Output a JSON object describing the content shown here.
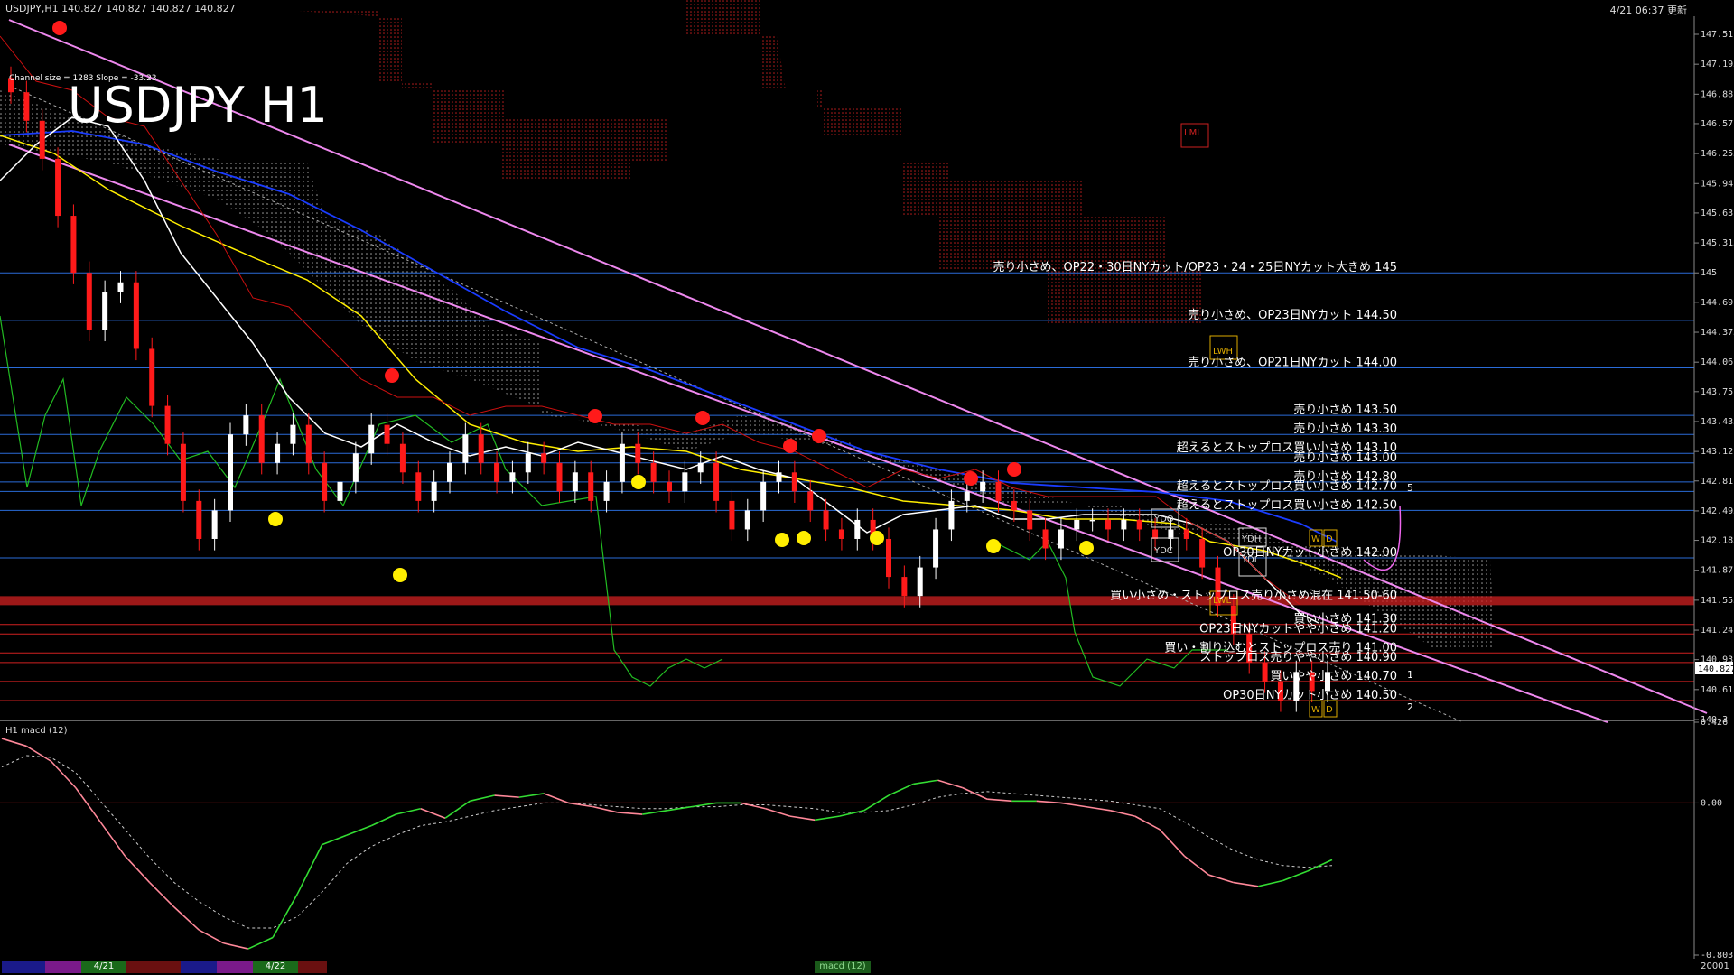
{
  "header": {
    "symbol_line": "USDJPY,H1  140.827 140.827 140.827 140.827",
    "datetime": "4/21 06:37 更新"
  },
  "chart_title": "USDJPY H1",
  "channel_info": "Channel size = 1283 Slope = -33.23",
  "colors": {
    "bg": "#000000",
    "bull": "#ffffff",
    "bear": "#ff1a1a",
    "sma_fast": "#ffffff",
    "sma_mid": "#ffee00",
    "sma_slow": "#1a3cff",
    "chikou": "#22bb22",
    "channel": "#ee88ee",
    "cloud_red": "#cc2020",
    "cloud_white": "#c8c8c8",
    "level_blue": "#2a6bd8",
    "level_red": "#d02020",
    "macd_up": "#33dd33",
    "macd_down": "#ff8899",
    "signal": "#cccccc"
  },
  "chart_data": [
    {
      "type": "line",
      "panel": "price",
      "symbol": "USDJPY",
      "timeframe": "H1",
      "ylim": [
        140.3,
        147.7
      ],
      "y_ticks": [
        147.51,
        147.195,
        146.88,
        146.57,
        146.255,
        145.94,
        145.63,
        145.315,
        145.0,
        144.69,
        144.375,
        144.06,
        143.75,
        143.435,
        143.12,
        142.81,
        142.495,
        142.185,
        141.87,
        141.555,
        141.24,
        140.93,
        140.615,
        140.3
      ],
      "current_price": "140.827",
      "price_closes": [
        146.9,
        146.6,
        146.2,
        145.6,
        145.0,
        144.4,
        144.8,
        144.9,
        144.2,
        143.6,
        143.2,
        142.6,
        142.2,
        142.5,
        143.3,
        143.5,
        143.0,
        143.2,
        143.4,
        143.0,
        142.6,
        142.8,
        143.1,
        143.4,
        143.2,
        142.9,
        142.6,
        142.8,
        143.0,
        143.3,
        143.0,
        142.8,
        142.9,
        143.1,
        143.0,
        142.7,
        142.9,
        142.6,
        142.8,
        143.2,
        143.0,
        142.8,
        142.7,
        142.9,
        143.0,
        142.6,
        142.3,
        142.5,
        142.8,
        142.9,
        142.7,
        142.5,
        142.3,
        142.2,
        142.4,
        142.2,
        141.8,
        141.6,
        141.9,
        142.3,
        142.6,
        142.7,
        142.8,
        142.6,
        142.5,
        142.3,
        142.1,
        142.3,
        142.4,
        142.4,
        142.3,
        142.4,
        142.3,
        142.2,
        142.3,
        142.2,
        141.9,
        141.5,
        141.2,
        140.9,
        140.7,
        140.5,
        140.8,
        140.6,
        140.8
      ],
      "levels": [
        {
          "price": 145.0,
          "color": "#2a6bd8",
          "label": "売り小さめ、OP22・30日NYカット/OP23・24・25日NYカット大きめ 145"
        },
        {
          "price": 144.5,
          "color": "#2a6bd8",
          "label": "売り小さめ、OP23日NYカット 144.50"
        },
        {
          "price": 144.0,
          "color": "#2a6bd8",
          "label": "売り小さめ、OP21日NYカット 144.00"
        },
        {
          "price": 143.5,
          "color": "#2a6bd8",
          "label": "売り小さめ 143.50"
        },
        {
          "price": 143.3,
          "color": "#2a6bd8",
          "label": "売り小さめ 143.30"
        },
        {
          "price": 143.1,
          "color": "#2a6bd8",
          "label": "超えるとストップロス買い小さめ 143.10"
        },
        {
          "price": 143.0,
          "color": "#2a6bd8",
          "label": "売り小さめ 143.00"
        },
        {
          "price": 142.8,
          "color": "#2a6bd8",
          "label": "売り小さめ 142.80"
        },
        {
          "price": 142.7,
          "color": "#2a6bd8",
          "label": "超えるとストップロス買い小さめ 142.70"
        },
        {
          "price": 142.5,
          "color": "#2a6bd8",
          "label": "超えるとストップロス買い小さめ 142.50"
        },
        {
          "price": 142.0,
          "color": "#2a6bd8",
          "label": "OP30日NYカット小さめ 142.00"
        },
        {
          "price": 141.55,
          "color": "#d02020",
          "label": "買い小さめ・ストップロス売り小さめ混在 141.50-60"
        },
        {
          "price": 141.3,
          "color": "#d02020",
          "label": "買い小さめ 141.30"
        },
        {
          "price": 141.2,
          "color": "#d02020",
          "label": "OP23日NYカットやや小さめ 141.20"
        },
        {
          "price": 141.0,
          "color": "#d02020",
          "label": "買い・割り込むとストップロス売り 141.00"
        },
        {
          "price": 140.9,
          "color": "#d02020",
          "label": "ストップロス売りやや小さめ 140.90"
        },
        {
          "price": 140.7,
          "color": "#d02020",
          "label": "買いやや小さめ 140.70"
        },
        {
          "price": 140.5,
          "color": "#d02020",
          "label": "OP30日NYカット小さめ 140.50"
        }
      ],
      "markers_text": [
        "LML",
        "LWH",
        "YDO",
        "YDC",
        "YDH",
        "YDL",
        "LWL",
        "W",
        "D",
        "W",
        "D"
      ],
      "right_numbers": [
        "5",
        "1",
        "2"
      ]
    },
    {
      "type": "line",
      "panel": "macd",
      "title": "H1  macd (12)",
      "ylim": [
        -0.803,
        0.426
      ],
      "y_ticks": [
        0.426,
        0.0,
        -0.803
      ],
      "zero_line": 0.0,
      "macd_values": [
        0.34,
        0.3,
        0.22,
        0.08,
        -0.1,
        -0.28,
        -0.42,
        -0.55,
        -0.67,
        -0.74,
        -0.77,
        -0.71,
        -0.48,
        -0.22,
        -0.17,
        -0.12,
        -0.06,
        -0.03,
        -0.08,
        0.01,
        0.04,
        0.03,
        0.05,
        -0.0,
        -0.02,
        -0.05,
        -0.06,
        -0.04,
        -0.02,
        0.0,
        0.0,
        -0.03,
        -0.07,
        -0.09,
        -0.07,
        -0.04,
        0.04,
        0.1,
        0.12,
        0.08,
        0.02,
        0.01,
        0.01,
        0.0,
        -0.02,
        -0.04,
        -0.07,
        -0.14,
        -0.28,
        -0.38,
        -0.42,
        -0.44,
        -0.41,
        -0.36,
        -0.3
      ],
      "signal_values": [
        0.19,
        0.25,
        0.24,
        0.16,
        0.01,
        -0.14,
        -0.29,
        -0.42,
        -0.52,
        -0.6,
        -0.66,
        -0.66,
        -0.6,
        -0.47,
        -0.32,
        -0.23,
        -0.17,
        -0.12,
        -0.1,
        -0.07,
        -0.04,
        -0.02,
        0.0,
        0.0,
        -0.01,
        -0.02,
        -0.03,
        -0.03,
        -0.02,
        -0.02,
        -0.01,
        -0.01,
        -0.02,
        -0.03,
        -0.05,
        -0.05,
        -0.04,
        -0.01,
        0.03,
        0.05,
        0.06,
        0.05,
        0.04,
        0.03,
        0.02,
        0.01,
        -0.01,
        -0.03,
        -0.1,
        -0.18,
        -0.25,
        -0.3,
        -0.33,
        -0.34,
        -0.33
      ]
    }
  ],
  "bottom": {
    "date_tabs": [
      "4/21",
      "4/22"
    ],
    "center_tab": "macd (12)",
    "right_label": "20001"
  }
}
